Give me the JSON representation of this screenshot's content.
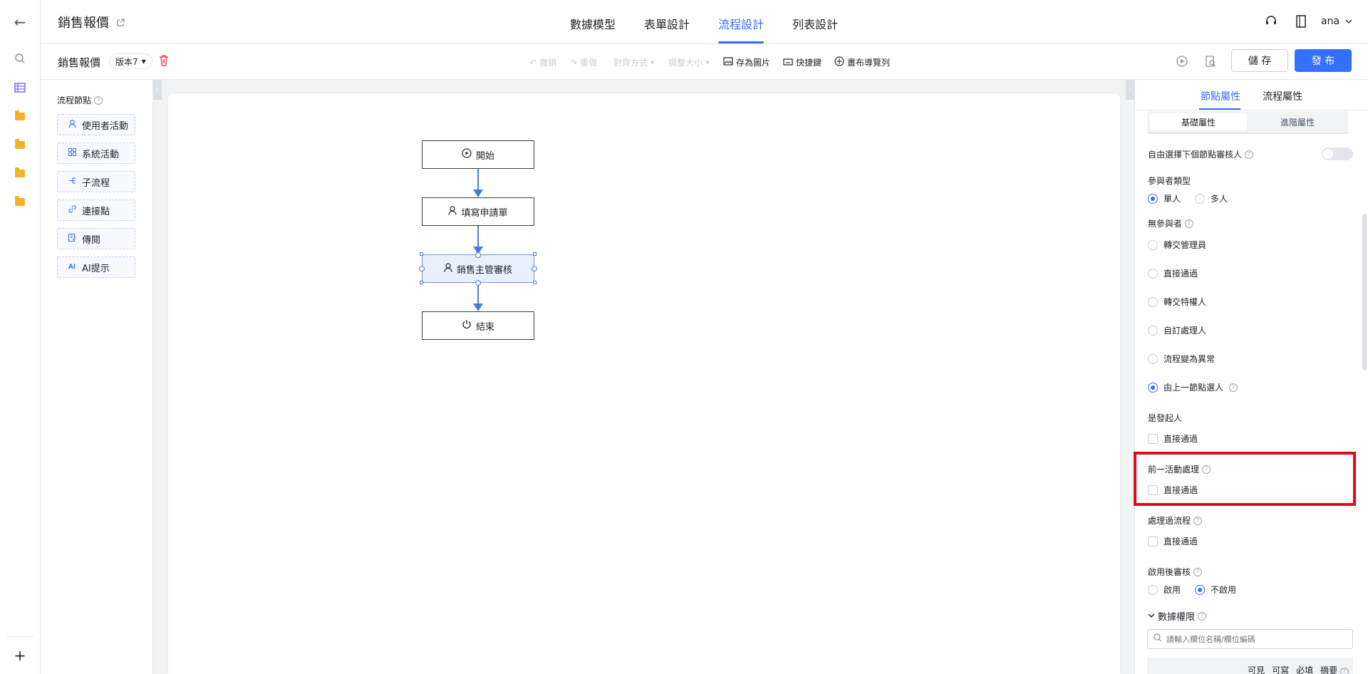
{
  "app": {
    "title": "銷售報價"
  },
  "header": {
    "tabs": [
      {
        "label": "數據模型"
      },
      {
        "label": "表單設計"
      },
      {
        "label": "流程設計",
        "active": true
      },
      {
        "label": "列表設計"
      }
    ],
    "user_name": "ana"
  },
  "toolbar": {
    "flow_name": "銷售報價",
    "version": "版本7",
    "undo": "撤銷",
    "redo": "重做",
    "align": "對齊方式",
    "resize": "調整大小",
    "save_image": "存為圖片",
    "shortcuts": "快捷鍵",
    "canvas_nav": "畫布導覽列",
    "save": "儲 存",
    "publish": "發 布"
  },
  "node_panel": {
    "title": "流程節點",
    "items": [
      {
        "label": "使用者活動",
        "icon": "user-icon"
      },
      {
        "label": "系統活動",
        "icon": "grid-icon"
      },
      {
        "label": "子流程",
        "icon": "subflow-icon"
      },
      {
        "label": "連接點",
        "icon": "link-icon"
      },
      {
        "label": "傳閱",
        "icon": "circulate-icon"
      },
      {
        "label": "AI提示",
        "icon": "ai-icon"
      }
    ]
  },
  "flow": {
    "nodes": [
      {
        "label": "開始",
        "icon": "play-icon"
      },
      {
        "label": "填寫申請單",
        "icon": "user-icon"
      },
      {
        "label": "銷售主管審核",
        "icon": "user-icon",
        "selected": true
      },
      {
        "label": "結束",
        "icon": "power-icon"
      }
    ]
  },
  "right_panel": {
    "tabs": [
      {
        "label": "節點屬性",
        "active": true
      },
      {
        "label": "流程屬性"
      }
    ],
    "subtabs": [
      {
        "label": "基礎屬性",
        "active": true
      },
      {
        "label": "進階屬性"
      }
    ],
    "free_select_label": "自由選擇下個節點審核人",
    "participant_type": {
      "label": "參與者類型",
      "options": [
        "單人",
        "多人"
      ],
      "selected": "單人"
    },
    "no_participant": {
      "label": "無參與者",
      "options": [
        "轉交管理員",
        "直接通過",
        "轉交特權人",
        "自訂處理人",
        "流程變為異常",
        "由上一節點選人"
      ],
      "selected": "由上一節點選人"
    },
    "is_initiator": {
      "label": "是發起人",
      "option": "直接通過"
    },
    "prev_activity": {
      "label": "前一活動處理",
      "option": "直接通過"
    },
    "processed_flow": {
      "label": "處理過流程",
      "option": "直接通過"
    },
    "post_review": {
      "label": "啟用後審核",
      "options": [
        "啟用",
        "不啟用"
      ],
      "selected": "不啟用"
    },
    "data_permission": {
      "label": "數據權限",
      "search_placeholder": "請輸入欄位名稱/欄位編碼",
      "columns": [
        "可見",
        "可寫",
        "必填",
        "摘要"
      ]
    }
  },
  "colors": {
    "accent": "#3370ff",
    "highlight": "#e4081a"
  }
}
